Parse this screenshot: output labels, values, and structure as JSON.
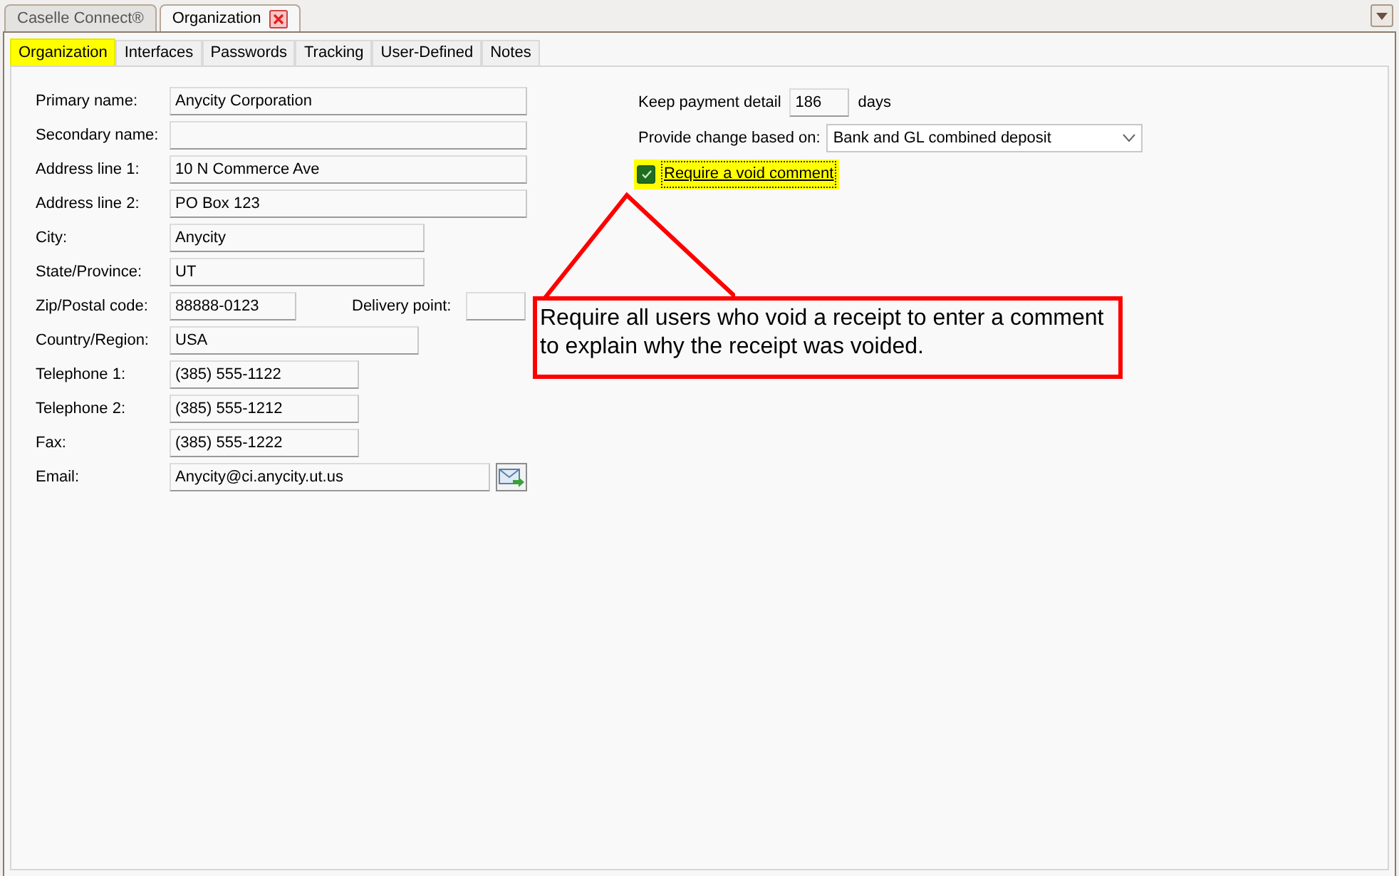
{
  "doc_tabs": [
    {
      "label": "Caselle Connect®",
      "selected": false,
      "closable": false
    },
    {
      "label": "Organization",
      "selected": true,
      "closable": true
    }
  ],
  "tabs": [
    {
      "label": "Organization",
      "selected": true
    },
    {
      "label": "Interfaces",
      "selected": false
    },
    {
      "label": "Passwords",
      "selected": false
    },
    {
      "label": "Tracking",
      "selected": false
    },
    {
      "label": "User-Defined",
      "selected": false
    },
    {
      "label": "Notes",
      "selected": false
    }
  ],
  "fields": [
    {
      "kind": "text",
      "label": "Primary name:",
      "value": "Anycity Corporation"
    },
    {
      "kind": "text",
      "label": "Secondary name:"
    },
    {
      "kind": "text",
      "label": "Address line 1:",
      "value": "10 N Commerce Ave"
    },
    {
      "kind": "text",
      "label": "Address line 2:",
      "value": "PO Box 123"
    },
    {
      "kind": "text",
      "label": "City:",
      "value": "Anycity"
    },
    {
      "kind": "text",
      "label": "State/Province:",
      "value": "UT"
    },
    {
      "kind": "pair",
      "label": "Zip/Postal code:",
      "value": "88888-0123",
      "second_label": "Delivery point:"
    },
    {
      "kind": "text",
      "label": "Country/Region:",
      "value": "USA"
    },
    {
      "kind": "text",
      "label": "Telephone 1:",
      "value": "(385) 555-1122"
    },
    {
      "kind": "text",
      "label": "Telephone 2:",
      "value": "(385) 555-1212"
    },
    {
      "kind": "text",
      "label": "Fax:",
      "value": "(385) 555-1222"
    },
    {
      "kind": "email",
      "label": "Email:",
      "value": "Anycity@ci.anycity.ut.us"
    }
  ],
  "payment": {
    "label": "Keep payment detail",
    "value": "186",
    "unit": "days"
  },
  "change": {
    "label": "Provide change based on:",
    "value": "Bank and GL combined deposit"
  },
  "void_comment": {
    "label": "Require a void comment",
    "checked": true
  },
  "callout": {
    "text": "Require all users who void a receipt to enter a comment to explain why the receipt was voided."
  }
}
